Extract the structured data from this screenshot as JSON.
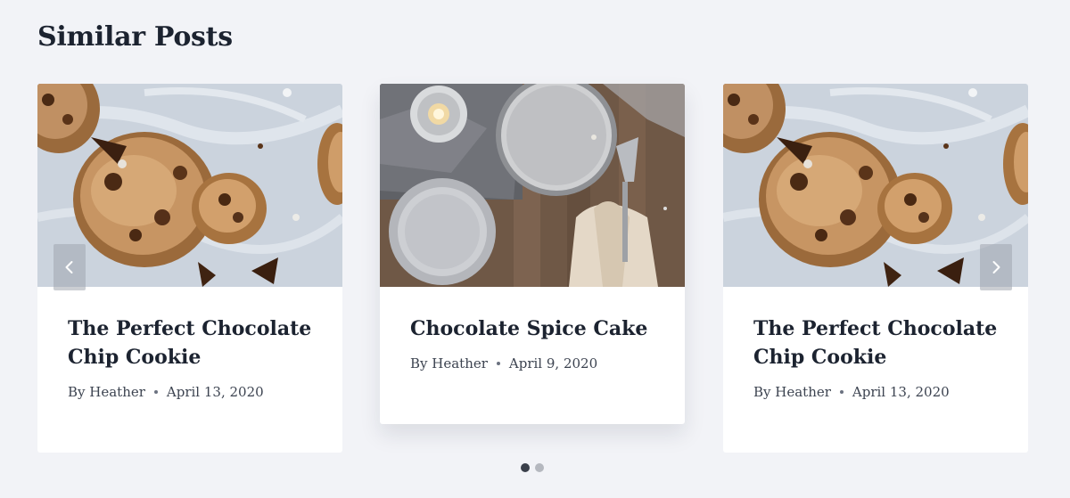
{
  "section": {
    "title": "Similar Posts"
  },
  "posts": [
    {
      "title": "The Perfect Chocolate Chip Cookie",
      "author": "By Heather",
      "date": "April 13, 2020",
      "image": "chocolate-chip-cookies-photo"
    },
    {
      "title": "Chocolate Spice Cake",
      "author": "By Heather",
      "date": "April 9, 2020",
      "image": "spice-cake-table-photo"
    },
    {
      "title": "The Perfect Chocolate Chip Cookie",
      "author": "By Heather",
      "date": "April 13, 2020",
      "image": "chocolate-chip-cookies-photo"
    }
  ],
  "carousel": {
    "prev_icon": "chevron-left-icon",
    "next_icon": "chevron-right-icon",
    "pages": 2,
    "active_page": 1
  },
  "colors": {
    "background": "#f2f3f7",
    "card": "#ffffff",
    "text": "#1c2330",
    "active_dot": "#3a3f4a",
    "inactive_dot": "#b5b8bf"
  }
}
